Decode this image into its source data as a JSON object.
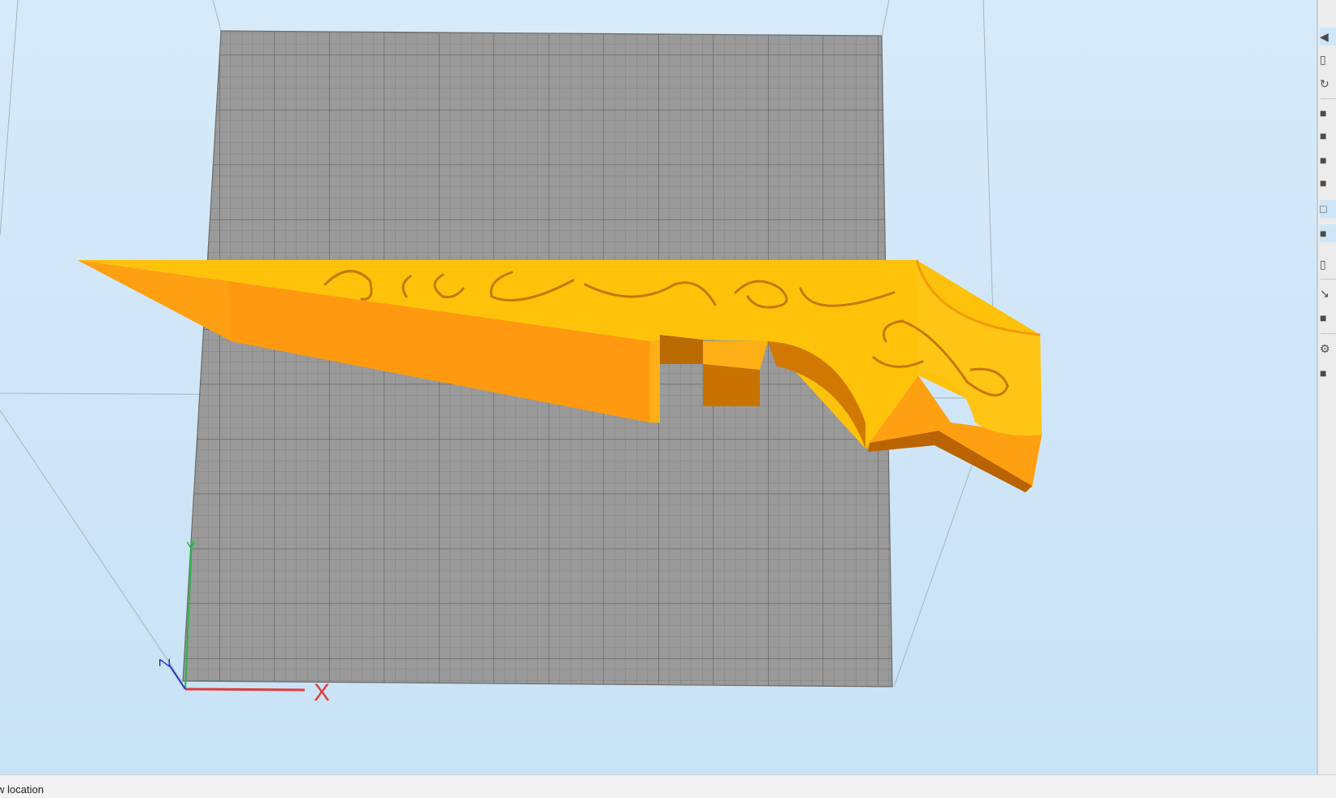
{
  "status_bar": {
    "text": "w location"
  },
  "axes": {
    "x_label": "X",
    "y_label": "Y",
    "z_label": "Z",
    "x_color": "#e23b3b",
    "y_color": "#2cb54a",
    "z_color": "#2430c8"
  },
  "model": {
    "color_top": "#ffc20a",
    "color_side": "#ff9f12",
    "color_shadow": "#cc7200"
  },
  "toolbar": {
    "items": [
      {
        "name": "collapse-arrow-icon"
      },
      {
        "name": "folder-icon"
      },
      {
        "name": "rotate-icon"
      },
      {
        "name": "view-cube-front-icon"
      },
      {
        "name": "view-cube-back-icon"
      },
      {
        "name": "view-cube-left-icon"
      },
      {
        "name": "view-cube-right-icon"
      },
      {
        "name": "view-cube-top-icon"
      },
      {
        "name": "view-cube-bottom-icon"
      },
      {
        "name": "perspective-icon"
      },
      {
        "name": "pointer-icon"
      },
      {
        "name": "delete-icon"
      },
      {
        "name": "gear-icon"
      },
      {
        "name": "layer-icon"
      }
    ]
  }
}
